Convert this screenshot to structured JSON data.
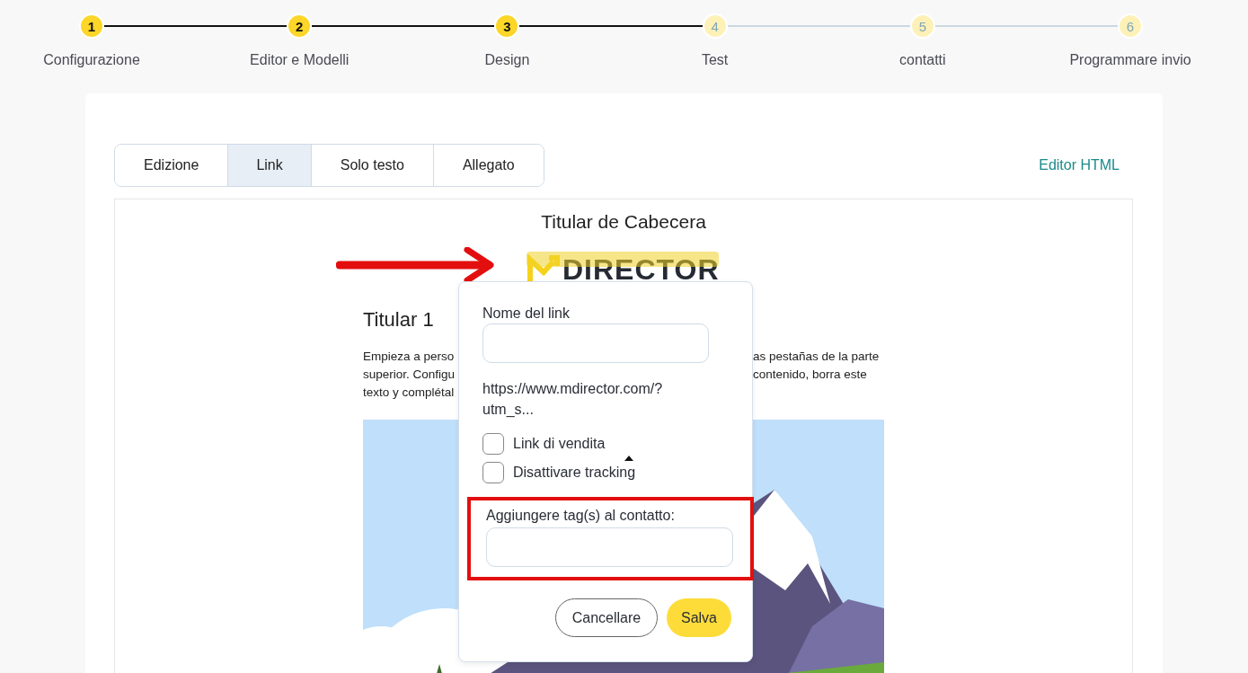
{
  "stepper": {
    "steps": [
      {
        "number": "1",
        "label": "Configurazione",
        "done": true
      },
      {
        "number": "2",
        "label": "Editor e Modelli",
        "done": true
      },
      {
        "number": "3",
        "label": "Design",
        "done": true
      },
      {
        "number": "4",
        "label": "Test",
        "done": false
      },
      {
        "number": "5",
        "label": "contatti",
        "done": false
      },
      {
        "number": "6",
        "label": "Programmare invio",
        "done": false
      }
    ]
  },
  "tabs": [
    {
      "label": "Edizione",
      "selected": false
    },
    {
      "label": "Link",
      "selected": true
    },
    {
      "label": "Solo testo",
      "selected": false
    },
    {
      "label": "Allegato",
      "selected": false
    }
  ],
  "editor_html_link": "Editor HTML",
  "email": {
    "header": "Titular de Cabecera",
    "logo_text": "DIRECTOR",
    "title": "Titular 1",
    "body_left": [
      "Empieza a perso",
      "superior. Configu",
      "texto y complétal"
    ],
    "body_right": [
      "as pestañas de la parte",
      "contenido, borra este"
    ]
  },
  "link_popup": {
    "name_label": "Nome del link",
    "url_lines": [
      "https://www.mdirector.com/?",
      "utm_s..."
    ],
    "checkboxes": [
      {
        "label": "Link di vendita",
        "checked": false
      },
      {
        "label": "Disattivare tracking",
        "checked": false
      }
    ],
    "tags_label": "Aggiungere tag(s) al contatto:",
    "tags_highlighted": true,
    "cancel_button": "Cancellare",
    "save_button": "Salva"
  }
}
